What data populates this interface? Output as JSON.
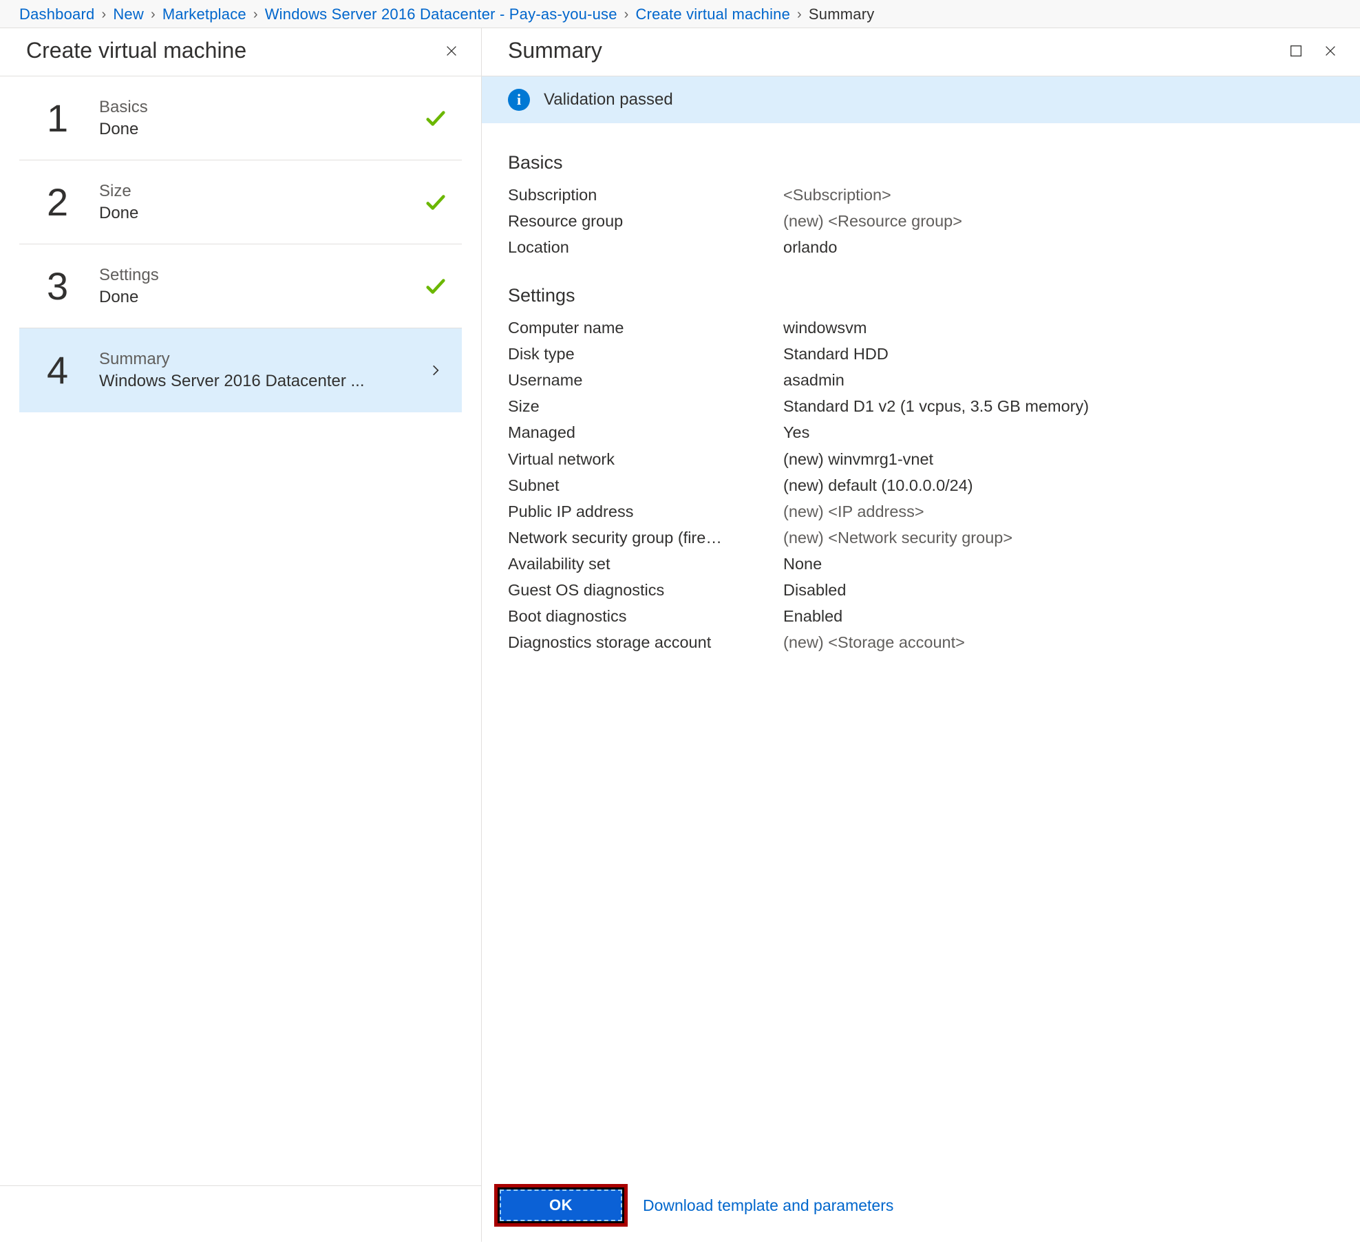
{
  "breadcrumb": [
    {
      "label": "Dashboard",
      "link": true
    },
    {
      "label": "New",
      "link": true
    },
    {
      "label": "Marketplace",
      "link": true
    },
    {
      "label": "Windows Server 2016 Datacenter - Pay-as-you-use",
      "link": true
    },
    {
      "label": "Create virtual machine",
      "link": true
    },
    {
      "label": "Summary",
      "link": false
    }
  ],
  "leftPanel": {
    "title": "Create virtual machine"
  },
  "steps": [
    {
      "num": "1",
      "title": "Basics",
      "sub": "Done",
      "status": "done"
    },
    {
      "num": "2",
      "title": "Size",
      "sub": "Done",
      "status": "done"
    },
    {
      "num": "3",
      "title": "Settings",
      "sub": "Done",
      "status": "done"
    },
    {
      "num": "4",
      "title": "Summary",
      "sub": "Windows Server 2016 Datacenter ...",
      "status": "current"
    }
  ],
  "rightPanel": {
    "title": "Summary",
    "validation": "Validation passed"
  },
  "sections": {
    "basics": {
      "heading": "Basics",
      "rows": [
        {
          "k": "Subscription",
          "v": "<Subscription>",
          "subtle": true
        },
        {
          "k": "Resource group",
          "v": "(new)  <Resource group>",
          "subtle": true
        },
        {
          "k": "Location",
          "v": " orlando",
          "subtle": false
        }
      ]
    },
    "settings": {
      "heading": "Settings",
      "rows": [
        {
          "k": "Computer name",
          "v": "windowsvm"
        },
        {
          "k": "Disk type",
          "v": "Standard HDD"
        },
        {
          "k": "Username",
          "v": "asadmin"
        },
        {
          "k": "Size",
          "v": "Standard D1 v2 (1 vcpus, 3.5 GB memory)"
        },
        {
          "k": "Managed",
          "v": "Yes"
        },
        {
          "k": "Virtual network",
          "v": "(new) winvmrg1-vnet"
        },
        {
          "k": "Subnet",
          "v": "(new) default (10.0.0.0/24)"
        },
        {
          "k": "Public IP address",
          "v": "(new)  <IP address>",
          "subtle": true
        },
        {
          "k": "Network security group (fire…",
          "v": "(new)  <Network security group>",
          "subtle": true
        },
        {
          "k": "Availability set",
          "v": "None"
        },
        {
          "k": "Guest OS diagnostics",
          "v": "Disabled"
        },
        {
          "k": "Boot diagnostics",
          "v": "Enabled"
        },
        {
          "k": "Diagnostics storage account",
          "v": "(new)  <Storage account>",
          "subtle": true
        }
      ]
    }
  },
  "footer": {
    "ok": "OK",
    "download": "Download template and parameters"
  }
}
